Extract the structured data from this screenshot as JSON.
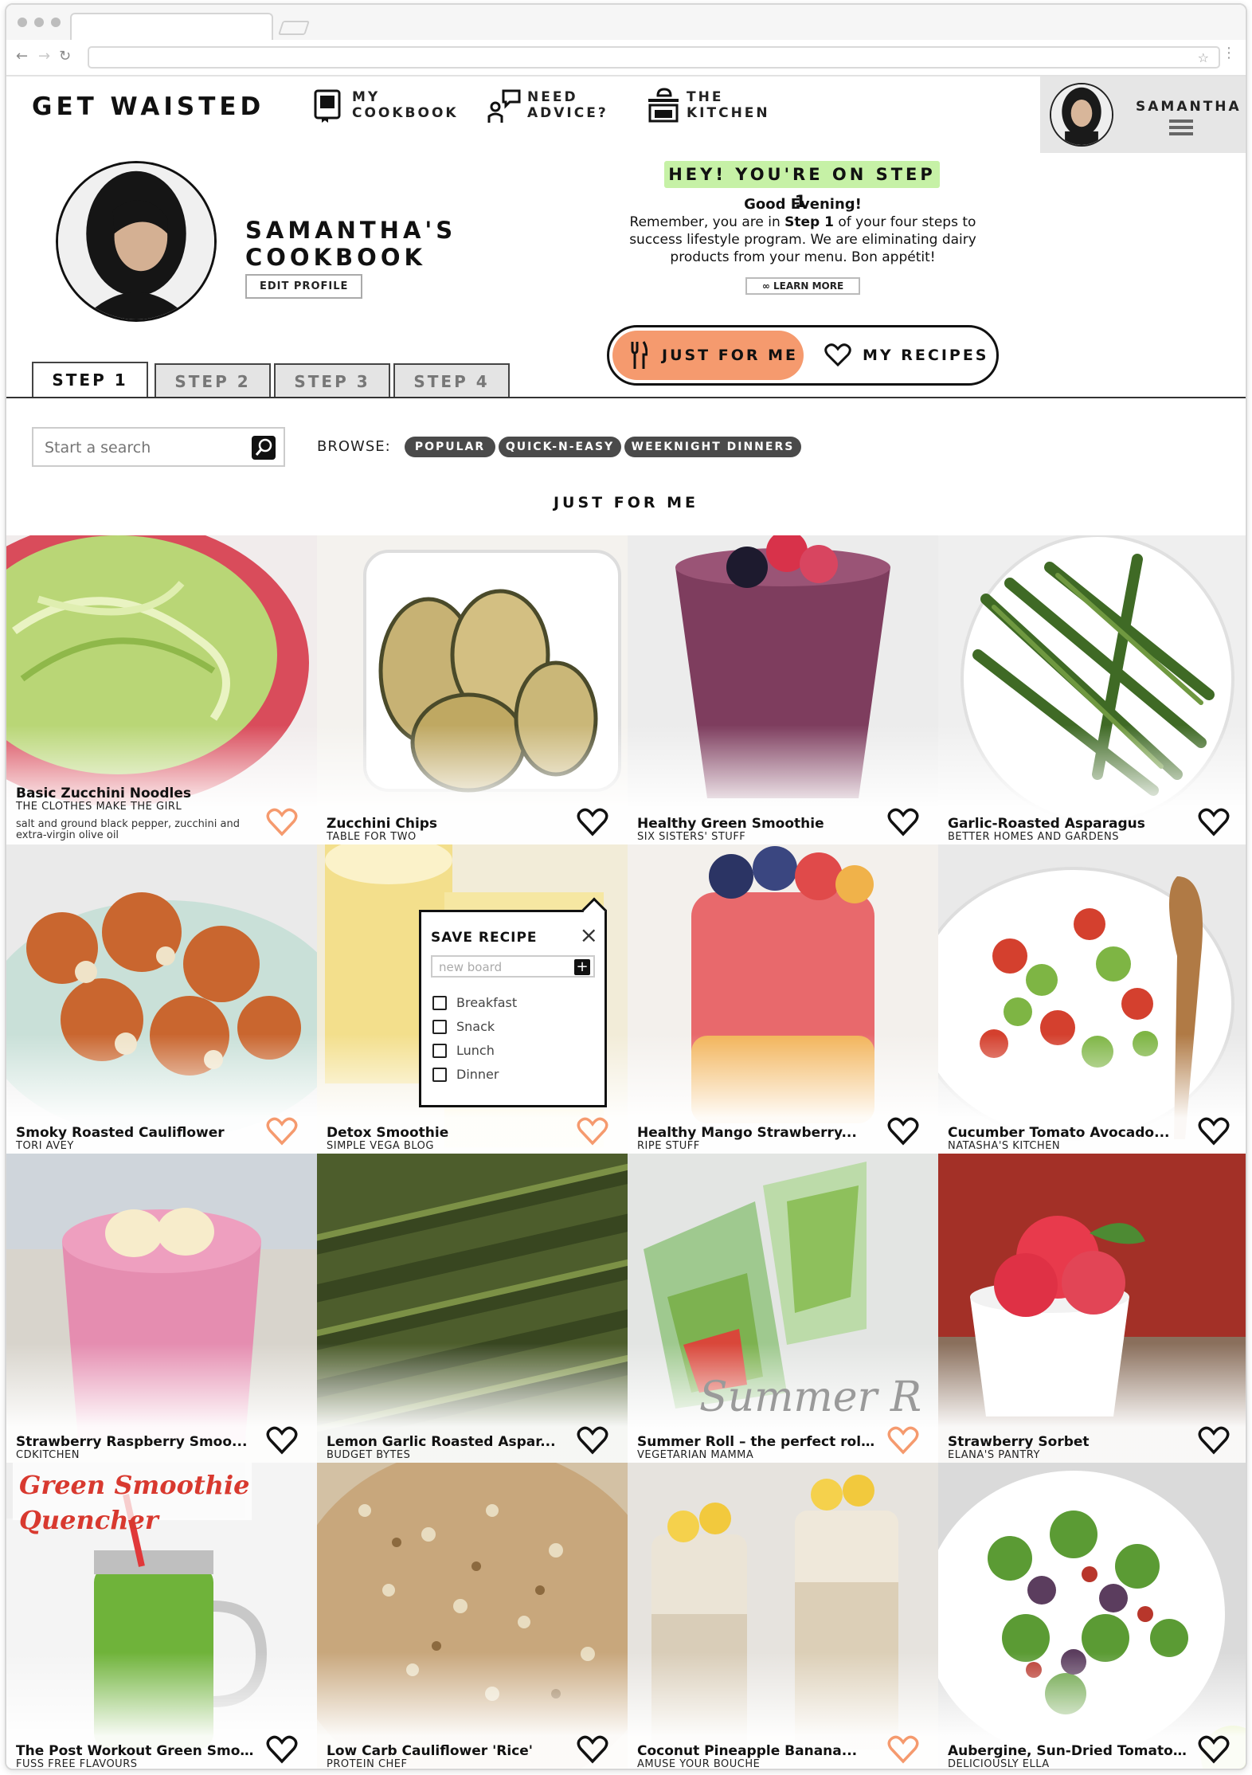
{
  "brand": {
    "name": "GET WAISTED",
    "accent": "#f59a6e",
    "banner_green": "#c6f1a6",
    "pill_color": "#4a4a4a"
  },
  "nav": [
    {
      "line1": "MY",
      "line2": "COOKBOOK",
      "icon": "cookbook-icon"
    },
    {
      "line1": "NEED",
      "line2": "ADVICE?",
      "icon": "advice-icon"
    },
    {
      "line1": "THE",
      "line2": "KITCHEN",
      "icon": "kitchen-icon"
    }
  ],
  "user": {
    "name": "SAMANTHA",
    "icon": "hamburger-menu-icon"
  },
  "profile": {
    "title_line1": "SAMANTHA'S",
    "title_line2": "COOKBOOK",
    "edit_label": "EDIT PROFILE"
  },
  "step_banner": "HEY! YOU'RE ON STEP 1",
  "greeting": {
    "title": "Good Evening!",
    "text_before": "Remember, you are in ",
    "text_bold": "Step 1",
    "text_after": " of your four steps to success lifestyle program. We are eliminating dairy products from your menu. Bon appétit!",
    "learn_more": "LEARN MORE"
  },
  "toggle": {
    "active": "JUST FOR ME",
    "other": "MY RECIPES"
  },
  "tabs": [
    "STEP 1",
    "STEP 2",
    "STEP 3",
    "STEP 4"
  ],
  "search": {
    "placeholder": "Start a search"
  },
  "browse": {
    "label": "BROWSE:",
    "pills": [
      "POPULAR",
      "QUICK-N-EASY",
      "WEEKNIGHT DINNERS"
    ]
  },
  "section_title": "JUST FOR ME",
  "recipes": [
    {
      "title": "Basic Zucchini Noodles",
      "source": "THE CLOTHES MAKE THE GIRL",
      "extra": "salt and ground black pepper, zucchini and extra-virgin olive oil",
      "saved": true
    },
    {
      "title": "Zucchini Chips",
      "source": "TABLE FOR TWO",
      "saved": false
    },
    {
      "title": "Healthy Green Smoothie",
      "source": "SIX SISTERS' STUFF",
      "saved": false
    },
    {
      "title": "Garlic-Roasted Asparagus",
      "source": "BETTER HOMES AND GARDENS",
      "saved": false
    },
    {
      "title": "Smoky Roasted Cauliflower",
      "source": "TORI AVEY",
      "saved": true
    },
    {
      "title": "Detox Smoothie",
      "source": "SIMPLE VEGA BLOG",
      "saved": true
    },
    {
      "title": "Healthy Mango Strawberry...",
      "source": "RIPE STUFF",
      "saved": false
    },
    {
      "title": "Cucumber Tomato Avocado...",
      "source": "NATASHA'S KITCHEN",
      "saved": false
    },
    {
      "title": "Strawberry Raspberry Smoo...",
      "source": "CDKITCHEN",
      "saved": false
    },
    {
      "title": "Lemon Garlic Roasted Aspar...",
      "source": "BUDGET BYTES",
      "saved": false
    },
    {
      "title": "Summer Roll – the perfect roll...",
      "source": "VEGETARIAN MAMMA",
      "saved": true
    },
    {
      "title": "Strawberry Sorbet",
      "source": "ELANA'S PANTRY",
      "saved": false
    },
    {
      "title": "The Post Workout Green Smo...",
      "source": "FUSS FREE FLAVOURS",
      "saved": false
    },
    {
      "title": "Low Carb Cauliflower 'Rice'",
      "source": "PROTEIN CHEF",
      "saved": false
    },
    {
      "title": "Coconut Pineapple Banana...",
      "source": "AMUSE YOUR BOUCHE",
      "saved": true
    },
    {
      "title": "Aubergine, Sun-Dried Tomato...",
      "source": "DELICIOUSLY ELLA",
      "saved": false
    }
  ],
  "image_texts": {
    "summer_roll_script": "Summer R",
    "green_quencher_line1": "Green Smoothie",
    "green_quencher_line2": "Quencher"
  },
  "save_popup": {
    "title": "SAVE RECIPE",
    "input_placeholder": "new board",
    "options": [
      "Breakfast",
      "Snack",
      "Lunch",
      "Dinner"
    ]
  }
}
